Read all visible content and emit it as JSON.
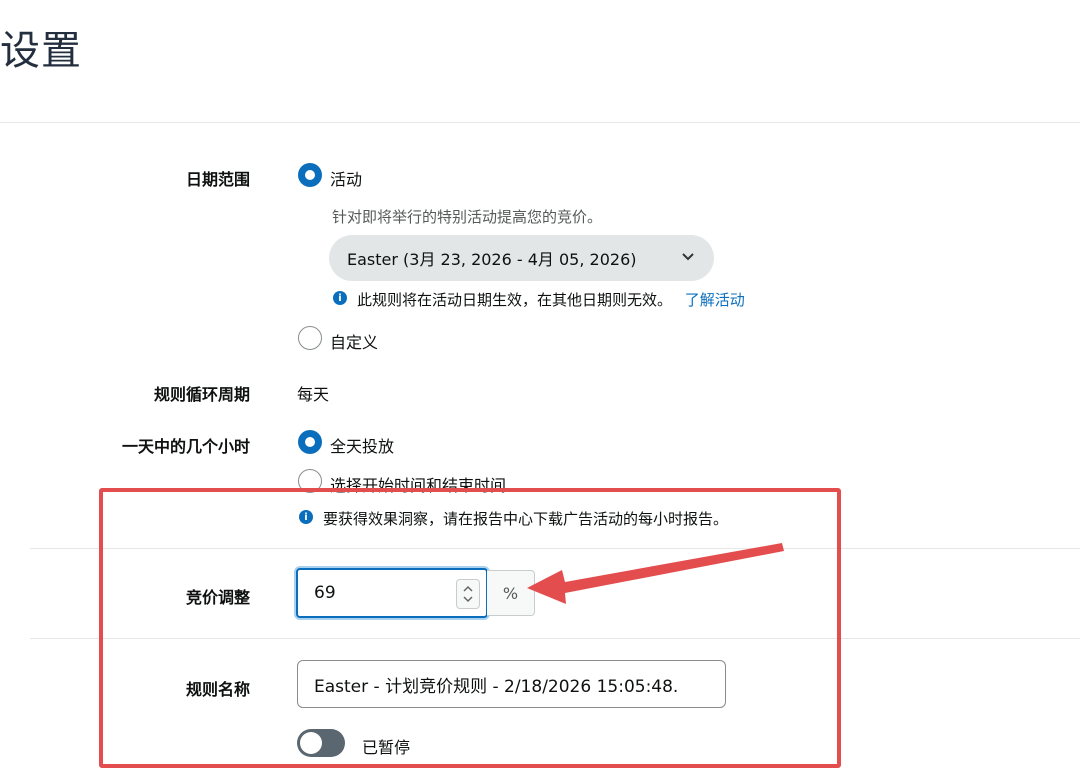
{
  "page_title": "设置",
  "date_range": {
    "label": "日期范围",
    "option_event": "活动",
    "event_description": "针对即将举行的特别活动提高您的竞价。",
    "event_select_value": "Easter (3月 23, 2026 - 4月 05, 2026)",
    "event_info_text": "此规则将在活动日期生效，在其他日期则无效。",
    "learn_link": "了解活动",
    "option_custom": "自定义"
  },
  "recurrence": {
    "label": "规则循环周期",
    "value": "每天"
  },
  "hours": {
    "label": "一天中的几个小时",
    "option_all_day": "全天投放",
    "option_custom": "选择开始时间和结束时间",
    "info_text": "要获得效果洞察，请在报告中心下载广告活动的每小时报告。"
  },
  "bid_adjustment": {
    "label": "竞价调整",
    "value": "69",
    "suffix": "%"
  },
  "rule_name": {
    "label": "规则名称",
    "value": "Easter - 计划竞价规则 - 2/18/2026 15:05:48.",
    "status_label": "已暂停"
  },
  "colors": {
    "accent": "#0a6ebd",
    "annotation_red": "#e34d4d"
  }
}
